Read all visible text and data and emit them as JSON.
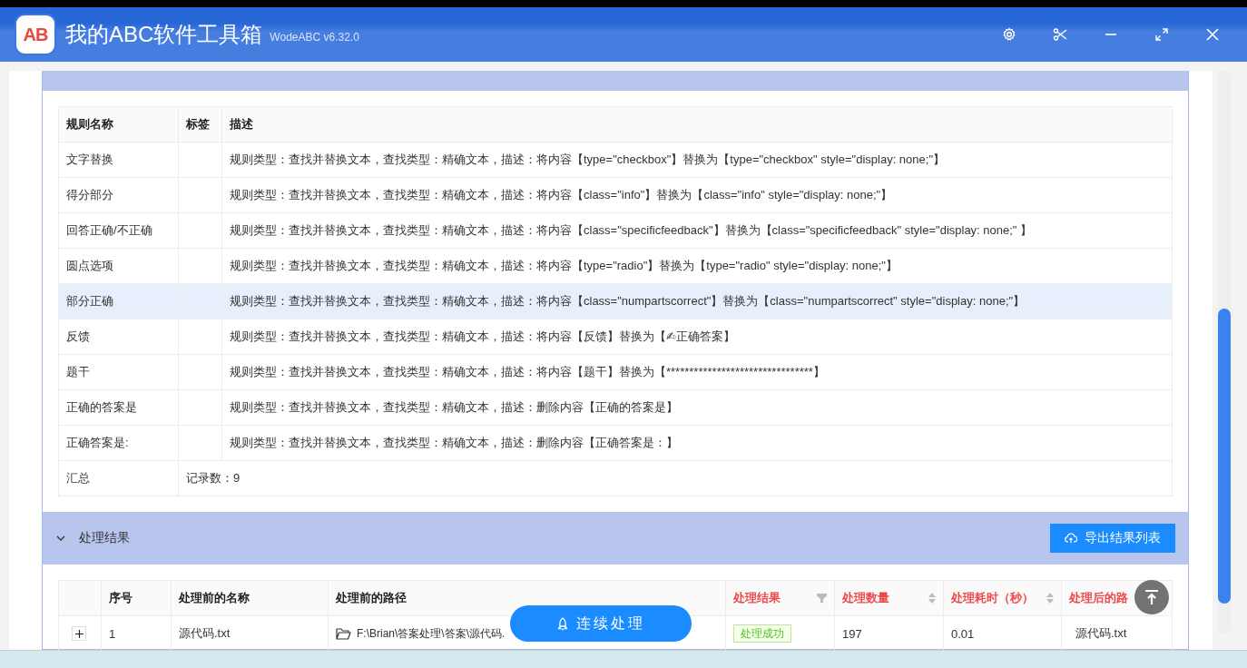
{
  "window": {
    "logo_text": "AB",
    "title": "我的ABC软件工具箱",
    "version": "WodeABC v6.32.0"
  },
  "rules_table": {
    "columns": [
      "规则名称",
      "标签",
      "描述"
    ],
    "rows": [
      {
        "name": "文字替换",
        "tag": "",
        "description": "规则类型：查找并替换文本，查找类型：精确文本，描述：将内容【type=\"checkbox\"】替换为【type=\"checkbox\" style=\"display: none;\"】",
        "selected": false
      },
      {
        "name": "得分部分",
        "tag": "",
        "description": "规则类型：查找并替换文本，查找类型：精确文本，描述：将内容【class=\"info\"】替换为【class=\"info\" style=\"display: none;\"】",
        "selected": false
      },
      {
        "name": "回答正确/不正确",
        "tag": "",
        "description": "规则类型：查找并替换文本，查找类型：精确文本，描述：将内容【class=\"specificfeedback\"】替换为【class=\"specificfeedback\" style=\"display: none;\" 】",
        "selected": false
      },
      {
        "name": "圆点选项",
        "tag": "",
        "description": "规则类型：查找并替换文本，查找类型：精确文本，描述：将内容【type=\"radio\"】替换为【type=\"radio\" style=\"display: none;\"】",
        "selected": false
      },
      {
        "name": "部分正确",
        "tag": "",
        "description": "规则类型：查找并替换文本，查找类型：精确文本，描述：将内容【class=\"numpartscorrect\"】替换为【class=\"numpartscorrect\" style=\"display: none;\"】",
        "selected": true
      },
      {
        "name": "反馈",
        "tag": "",
        "description": "规则类型：查找并替换文本，查找类型：精确文本，描述：将内容【反馈】替换为【✍正确答案】",
        "selected": false
      },
      {
        "name": "题干",
        "tag": "",
        "description": "规则类型：查找并替换文本，查找类型：精确文本，描述：将内容【题干】替换为【********************************】",
        "selected": false
      },
      {
        "name": "正确的答案是",
        "tag": "",
        "description": "规则类型：查找并替换文本，查找类型：精确文本，描述：删除内容【正确的答案是】",
        "selected": false
      },
      {
        "name": "正确答案是:",
        "tag": "",
        "description": "规则类型：查找并替换文本，查找类型：精确文本，描述：删除内容【正确答案是：】",
        "selected": false
      }
    ],
    "summary": {
      "label": "汇总",
      "value": "记录数：9"
    }
  },
  "results_section": {
    "title": "处理结果",
    "expanded": true,
    "export_button": "导出结果列表"
  },
  "results_table": {
    "columns": [
      {
        "emphasized": false,
        "filterable": false,
        "sortable": false
      },
      {
        "label": "序号",
        "emphasized": false,
        "filterable": false,
        "sortable": false
      },
      {
        "label": "处理前的名称",
        "emphasized": false,
        "filterable": false,
        "sortable": false
      },
      {
        "label": "处理前的路径",
        "emphasized": false,
        "filterable": false,
        "sortable": false
      },
      {
        "label": "处理结果",
        "emphasized": true,
        "filterable": true,
        "sortable": false
      },
      {
        "label": "处理数量",
        "emphasized": true,
        "filterable": false,
        "sortable": true
      },
      {
        "label": "处理耗时（秒）",
        "emphasized": true,
        "filterable": false,
        "sortable": true
      },
      {
        "label": "处理后的路",
        "emphasized": true,
        "filterable": false,
        "sortable": false
      }
    ],
    "rows": [
      {
        "index": "1",
        "name": "源代码.txt",
        "path": "F:\\Brian\\答案处理\\答案\\源代码.",
        "result": "处理成功",
        "count": "197",
        "time": "0.01",
        "new_path": "源代码.txt"
      }
    ]
  },
  "float_button": "连续处理"
}
